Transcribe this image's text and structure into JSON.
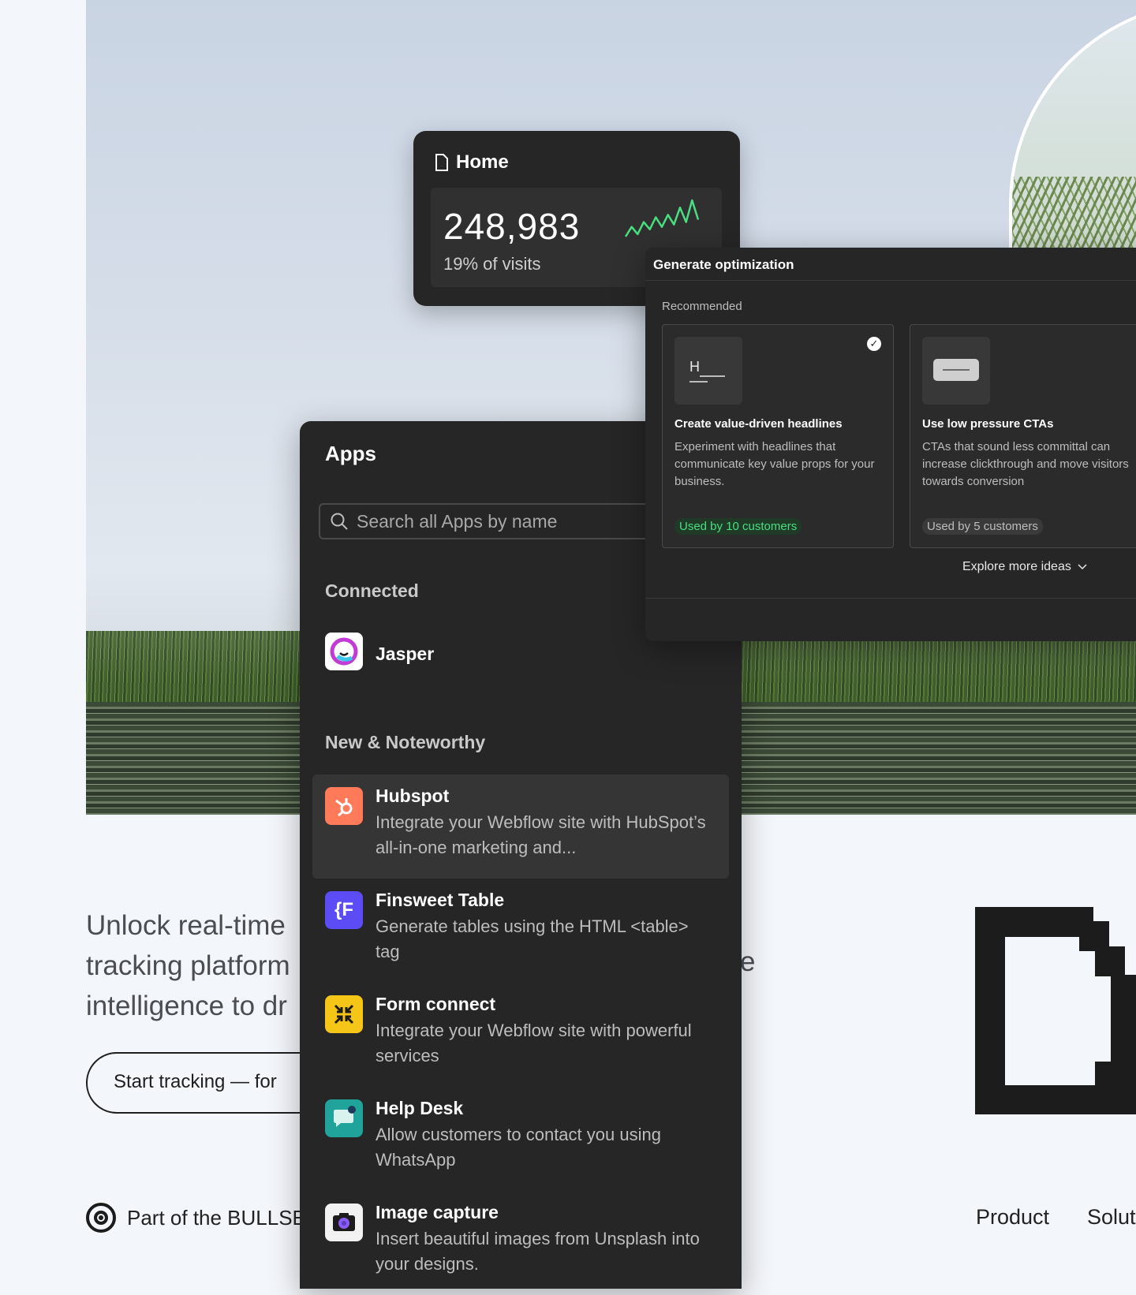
{
  "hero": {
    "headline": "Unlock real-time\ntracking platform\nintelligence to dr",
    "headline_trailing": "e",
    "cta_label": "Start tracking — for",
    "part_of": "Part of the BULLSE",
    "nav": [
      "Product",
      "Solut"
    ]
  },
  "home_card": {
    "title": "Home",
    "value": "248,983",
    "subtitle": "19% of visits",
    "sparkline_color": "#4ade80",
    "sparkline_values": [
      2,
      6,
      3,
      8,
      5,
      10,
      6,
      11,
      7,
      14,
      8,
      17,
      9
    ]
  },
  "generate": {
    "title": "Generate optimization",
    "recommended": "Recommended",
    "ideas": [
      {
        "title": "Create value-driven headlines",
        "description": "Experiment with headlines that communicate key value props for your business.",
        "badge": "Used by 10 customers",
        "badge_color": "#4ade80",
        "selected": true,
        "thumb_icon": "headline-icon"
      },
      {
        "title": "Use low pressure CTAs",
        "description": "CTAs that sound less committal can increase clickthrough and move visitors towards conversion",
        "badge": "Used by 5 customers",
        "badge_color": "#bdbdbd",
        "selected": false,
        "thumb_icon": "button-icon"
      }
    ],
    "explore": "Explore more ideas"
  },
  "apps": {
    "title": "Apps",
    "search_placeholder": "Search all Apps by name",
    "connected_label": "Connected",
    "connected": [
      {
        "name": "Jasper",
        "icon": "jasper-icon"
      }
    ],
    "noteworthy_label": "New & Noteworthy",
    "noteworthy": [
      {
        "name": "Hubspot",
        "description": "Integrate your Webflow site with HubSpot’s all-in-one marketing and...",
        "icon": "hubspot-icon",
        "color": "#ff7a59"
      },
      {
        "name": "Finsweet Table",
        "description": "Generate tables using the HTML <table> tag",
        "icon": "finsweet-icon",
        "color": "#5b4cf5",
        "glyph": "{F"
      },
      {
        "name": "Form connect",
        "description": "Integrate your Webflow site with powerful services",
        "icon": "form-connect-icon",
        "color": "#f5c518"
      },
      {
        "name": "Help Desk",
        "description": "Allow customers to contact you using WhatsApp",
        "icon": "help-desk-icon",
        "color": "#1fa39a"
      },
      {
        "name": "Image capture",
        "description": "Insert beautiful images from Unsplash into your designs.",
        "icon": "image-capture-icon",
        "color": "#f2f2f2"
      }
    ]
  }
}
